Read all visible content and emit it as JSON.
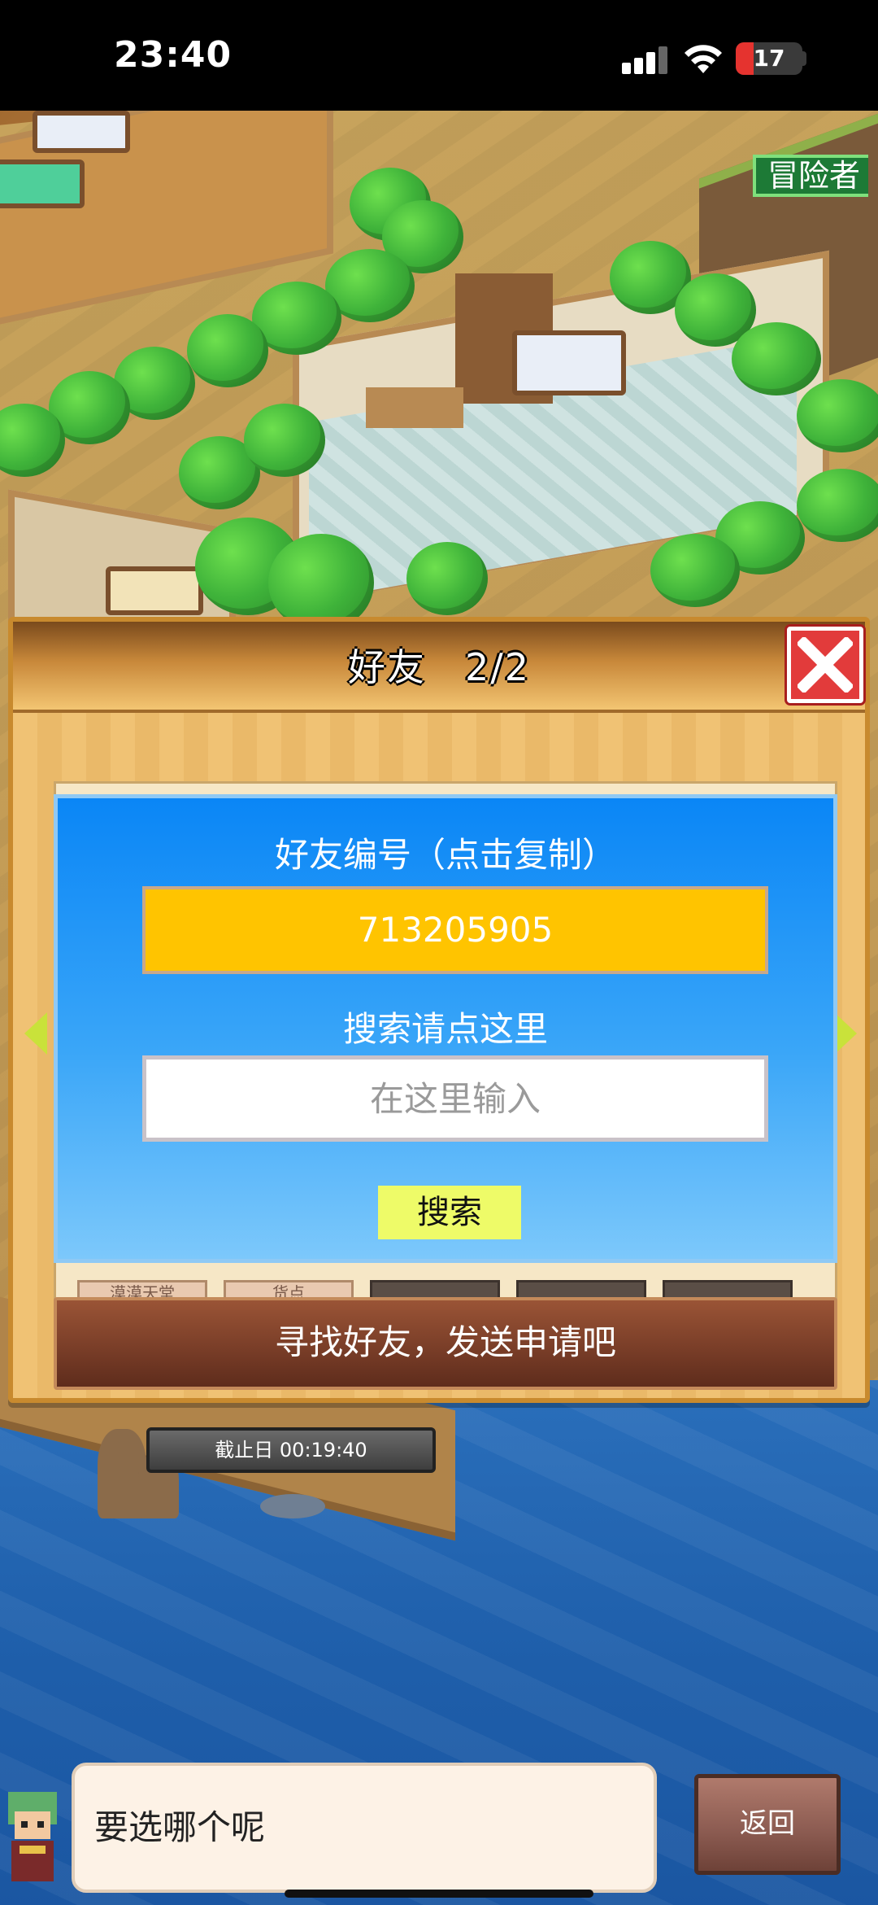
{
  "status_bar": {
    "time": "23:40",
    "battery_level": "17",
    "battery_fraction": 0.17,
    "icons": [
      "signal-icon",
      "wifi-icon",
      "battery-icon"
    ]
  },
  "scene": {
    "adventurer_tag": "冒险者"
  },
  "friend_dialog": {
    "title": "好友　2/2",
    "friend_id_label": "好友编号（点击复制）",
    "friend_id_value": "713205905",
    "search_label": "搜索请点这里",
    "search_placeholder": "在这里输入",
    "search_button": "搜索",
    "find_friends_button": "寻找好友，发送申请吧",
    "partial_tabs": [
      "漠漠天堂",
      "货点"
    ]
  },
  "deadline": {
    "text": "截止日 00:19:40"
  },
  "bottom_dialog": {
    "message": "要选哪个呢",
    "back_button": "返回"
  },
  "colors": {
    "panel_blue": "#0a86f6",
    "id_yellow": "#ffc400",
    "search_button": "#eefb68",
    "close_red": "#e23b3b",
    "find_button_brown": "#7a3e28"
  }
}
